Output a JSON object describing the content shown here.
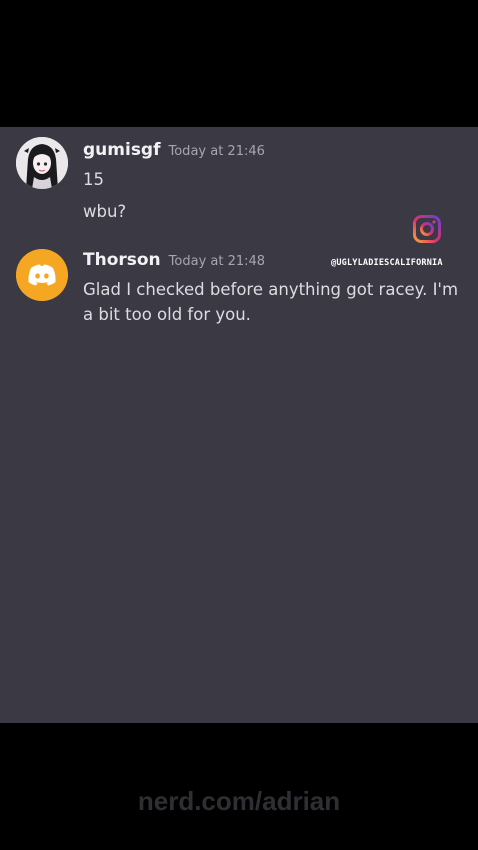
{
  "messages": [
    {
      "username": "gumisgf",
      "timestamp": "Today at 21:46",
      "lines": [
        "15",
        "wbu?"
      ],
      "avatar": "anime-girl-avatar"
    },
    {
      "username": "Thorson",
      "timestamp": "Today at 21:48",
      "lines": [
        "Glad I checked before anything got racey. I'm a bit too old for you."
      ],
      "avatar": "discord-logo-avatar"
    }
  ],
  "overlay": {
    "instagram_handle": "@UGLYLADIESCALIFORNIA",
    "instagram_icon": "instagram-icon"
  },
  "watermark": "nerd.com/adrian",
  "colors": {
    "panel_bg": "#3a3944",
    "discord_avatar_bg": "#f5a623",
    "username": "#f2f2f4",
    "timestamp": "#a6a7ad"
  }
}
